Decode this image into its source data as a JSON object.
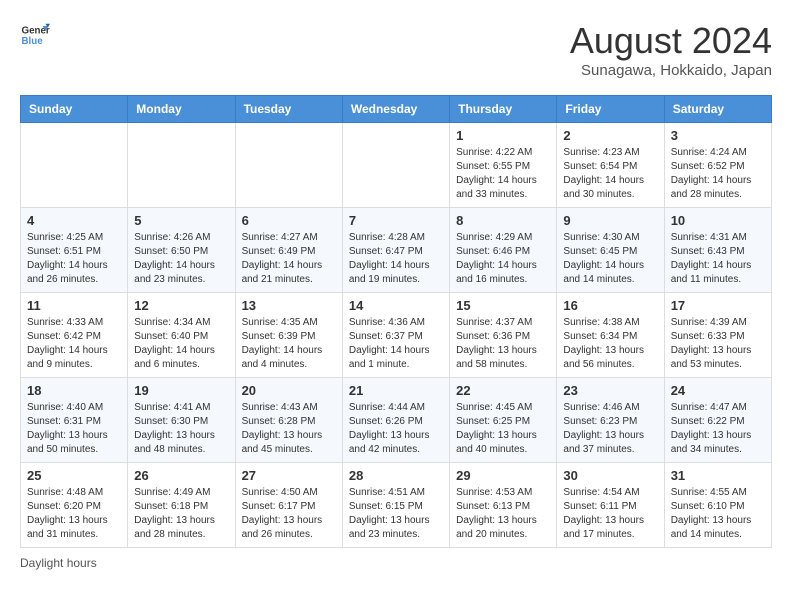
{
  "header": {
    "logo_line1": "General",
    "logo_line2": "Blue",
    "month": "August 2024",
    "location": "Sunagawa, Hokkaido, Japan"
  },
  "days_of_week": [
    "Sunday",
    "Monday",
    "Tuesday",
    "Wednesday",
    "Thursday",
    "Friday",
    "Saturday"
  ],
  "weeks": [
    [
      {
        "day": "",
        "info": ""
      },
      {
        "day": "",
        "info": ""
      },
      {
        "day": "",
        "info": ""
      },
      {
        "day": "",
        "info": ""
      },
      {
        "day": "1",
        "info": "Sunrise: 4:22 AM\nSunset: 6:55 PM\nDaylight: 14 hours\nand 33 minutes."
      },
      {
        "day": "2",
        "info": "Sunrise: 4:23 AM\nSunset: 6:54 PM\nDaylight: 14 hours\nand 30 minutes."
      },
      {
        "day": "3",
        "info": "Sunrise: 4:24 AM\nSunset: 6:52 PM\nDaylight: 14 hours\nand 28 minutes."
      }
    ],
    [
      {
        "day": "4",
        "info": "Sunrise: 4:25 AM\nSunset: 6:51 PM\nDaylight: 14 hours\nand 26 minutes."
      },
      {
        "day": "5",
        "info": "Sunrise: 4:26 AM\nSunset: 6:50 PM\nDaylight: 14 hours\nand 23 minutes."
      },
      {
        "day": "6",
        "info": "Sunrise: 4:27 AM\nSunset: 6:49 PM\nDaylight: 14 hours\nand 21 minutes."
      },
      {
        "day": "7",
        "info": "Sunrise: 4:28 AM\nSunset: 6:47 PM\nDaylight: 14 hours\nand 19 minutes."
      },
      {
        "day": "8",
        "info": "Sunrise: 4:29 AM\nSunset: 6:46 PM\nDaylight: 14 hours\nand 16 minutes."
      },
      {
        "day": "9",
        "info": "Sunrise: 4:30 AM\nSunset: 6:45 PM\nDaylight: 14 hours\nand 14 minutes."
      },
      {
        "day": "10",
        "info": "Sunrise: 4:31 AM\nSunset: 6:43 PM\nDaylight: 14 hours\nand 11 minutes."
      }
    ],
    [
      {
        "day": "11",
        "info": "Sunrise: 4:33 AM\nSunset: 6:42 PM\nDaylight: 14 hours\nand 9 minutes."
      },
      {
        "day": "12",
        "info": "Sunrise: 4:34 AM\nSunset: 6:40 PM\nDaylight: 14 hours\nand 6 minutes."
      },
      {
        "day": "13",
        "info": "Sunrise: 4:35 AM\nSunset: 6:39 PM\nDaylight: 14 hours\nand 4 minutes."
      },
      {
        "day": "14",
        "info": "Sunrise: 4:36 AM\nSunset: 6:37 PM\nDaylight: 14 hours\nand 1 minute."
      },
      {
        "day": "15",
        "info": "Sunrise: 4:37 AM\nSunset: 6:36 PM\nDaylight: 13 hours\nand 58 minutes."
      },
      {
        "day": "16",
        "info": "Sunrise: 4:38 AM\nSunset: 6:34 PM\nDaylight: 13 hours\nand 56 minutes."
      },
      {
        "day": "17",
        "info": "Sunrise: 4:39 AM\nSunset: 6:33 PM\nDaylight: 13 hours\nand 53 minutes."
      }
    ],
    [
      {
        "day": "18",
        "info": "Sunrise: 4:40 AM\nSunset: 6:31 PM\nDaylight: 13 hours\nand 50 minutes."
      },
      {
        "day": "19",
        "info": "Sunrise: 4:41 AM\nSunset: 6:30 PM\nDaylight: 13 hours\nand 48 minutes."
      },
      {
        "day": "20",
        "info": "Sunrise: 4:43 AM\nSunset: 6:28 PM\nDaylight: 13 hours\nand 45 minutes."
      },
      {
        "day": "21",
        "info": "Sunrise: 4:44 AM\nSunset: 6:26 PM\nDaylight: 13 hours\nand 42 minutes."
      },
      {
        "day": "22",
        "info": "Sunrise: 4:45 AM\nSunset: 6:25 PM\nDaylight: 13 hours\nand 40 minutes."
      },
      {
        "day": "23",
        "info": "Sunrise: 4:46 AM\nSunset: 6:23 PM\nDaylight: 13 hours\nand 37 minutes."
      },
      {
        "day": "24",
        "info": "Sunrise: 4:47 AM\nSunset: 6:22 PM\nDaylight: 13 hours\nand 34 minutes."
      }
    ],
    [
      {
        "day": "25",
        "info": "Sunrise: 4:48 AM\nSunset: 6:20 PM\nDaylight: 13 hours\nand 31 minutes."
      },
      {
        "day": "26",
        "info": "Sunrise: 4:49 AM\nSunset: 6:18 PM\nDaylight: 13 hours\nand 28 minutes."
      },
      {
        "day": "27",
        "info": "Sunrise: 4:50 AM\nSunset: 6:17 PM\nDaylight: 13 hours\nand 26 minutes."
      },
      {
        "day": "28",
        "info": "Sunrise: 4:51 AM\nSunset: 6:15 PM\nDaylight: 13 hours\nand 23 minutes."
      },
      {
        "day": "29",
        "info": "Sunrise: 4:53 AM\nSunset: 6:13 PM\nDaylight: 13 hours\nand 20 minutes."
      },
      {
        "day": "30",
        "info": "Sunrise: 4:54 AM\nSunset: 6:11 PM\nDaylight: 13 hours\nand 17 minutes."
      },
      {
        "day": "31",
        "info": "Sunrise: 4:55 AM\nSunset: 6:10 PM\nDaylight: 13 hours\nand 14 minutes."
      }
    ]
  ],
  "footer": {
    "note": "Daylight hours"
  }
}
